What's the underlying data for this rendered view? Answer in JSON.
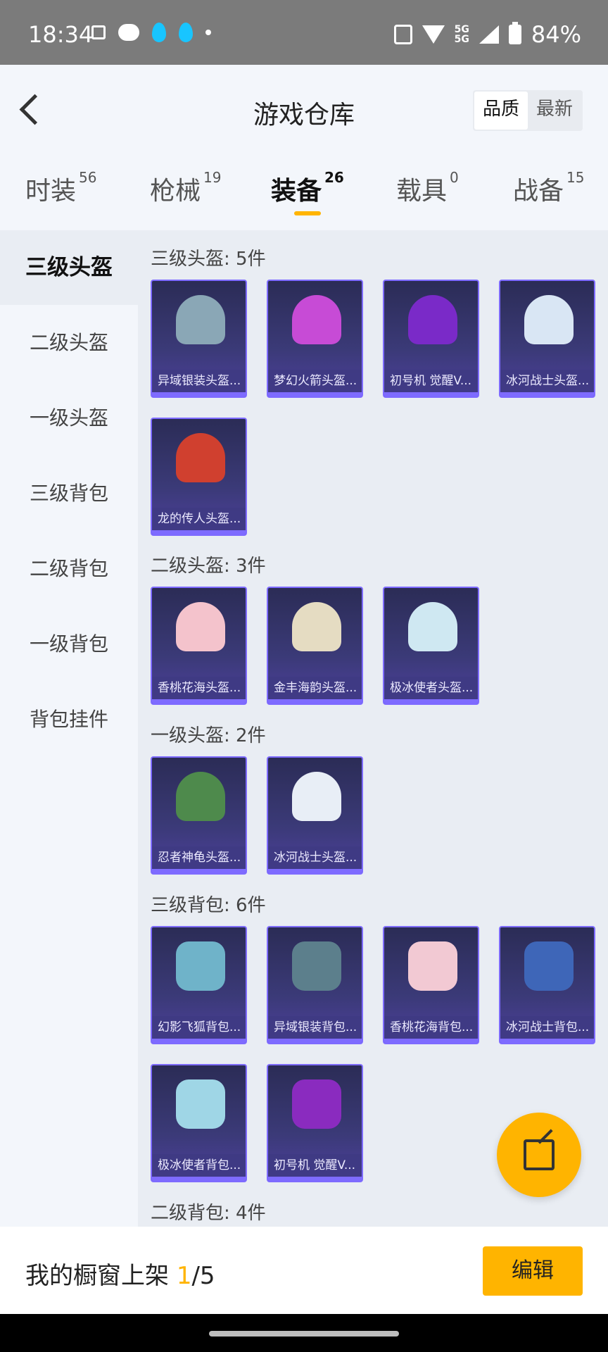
{
  "status": {
    "time": "18:34",
    "network": "5G",
    "battery": "84%"
  },
  "header": {
    "title": "游戏仓库",
    "sort_options": [
      "品质",
      "最新"
    ]
  },
  "tabs": [
    {
      "label": "时装",
      "count": "56"
    },
    {
      "label": "枪械",
      "count": "19"
    },
    {
      "label": "装备",
      "count": "26"
    },
    {
      "label": "载具",
      "count": "0"
    },
    {
      "label": "战备",
      "count": "15"
    }
  ],
  "sidebar": {
    "items": [
      "三级头盔",
      "二级头盔",
      "一级头盔",
      "三级背包",
      "二级背包",
      "一级背包",
      "背包挂件"
    ]
  },
  "sections": [
    {
      "title": "三级头盔: 5件",
      "items": [
        {
          "name": "异域银装头盔...",
          "icon": "silver-helmet-icon",
          "color": "#8aa7b6"
        },
        {
          "name": "梦幻火箭头盔...",
          "icon": "rocket-helmet-icon",
          "color": "#c74bd6"
        },
        {
          "name": "初号机 觉醒V...",
          "icon": "eva-helmet-icon",
          "color": "#7a2ac8"
        },
        {
          "name": "冰河战士头盔...",
          "icon": "ice-warrior-helmet-icon",
          "color": "#d9e6f4"
        },
        {
          "name": "龙的传人头盔...",
          "icon": "dragon-helmet-icon",
          "color": "#d0402f"
        }
      ]
    },
    {
      "title": "二级头盔: 3件",
      "items": [
        {
          "name": "香桃花海头盔...",
          "icon": "peach-helmet-icon",
          "color": "#f4c3cc"
        },
        {
          "name": "金丰海韵头盔...",
          "icon": "golden-helmet-icon",
          "color": "#e5dcc2"
        },
        {
          "name": "极冰使者头盔...",
          "icon": "ice-envoy-helmet-icon",
          "color": "#cfe8f2"
        }
      ]
    },
    {
      "title": "一级头盔: 2件",
      "items": [
        {
          "name": "忍者神龟头盔...",
          "icon": "ninja-turtle-helmet-icon",
          "color": "#4e8a4c"
        },
        {
          "name": "冰河战士头盔...",
          "icon": "ice-warrior-helmet-icon",
          "color": "#e8eef6"
        }
      ]
    },
    {
      "title": "三级背包: 6件",
      "items": [
        {
          "name": "幻影飞狐背包...",
          "icon": "phantom-fox-backpack-icon",
          "color": "#6fb3c9"
        },
        {
          "name": "异域银装背包...",
          "icon": "silver-backpack-icon",
          "color": "#5c7f8c"
        },
        {
          "name": "香桃花海背包...",
          "icon": "peach-backpack-icon",
          "color": "#f2c9d3"
        },
        {
          "name": "冰河战士背包...",
          "icon": "ice-warrior-backpack-icon",
          "color": "#3e66b8"
        },
        {
          "name": "极冰使者背包...",
          "icon": "ice-envoy-backpack-icon",
          "color": "#9fd6e6"
        },
        {
          "name": "初号机 觉醒V...",
          "icon": "eva-backpack-icon",
          "color": "#8a2bbf"
        }
      ]
    },
    {
      "title": "二级背包: 4件",
      "items": []
    }
  ],
  "footer": {
    "shelf_label": "我的橱窗上架",
    "shelf_count": "1",
    "shelf_total": "/5",
    "edit_label": "编辑"
  }
}
